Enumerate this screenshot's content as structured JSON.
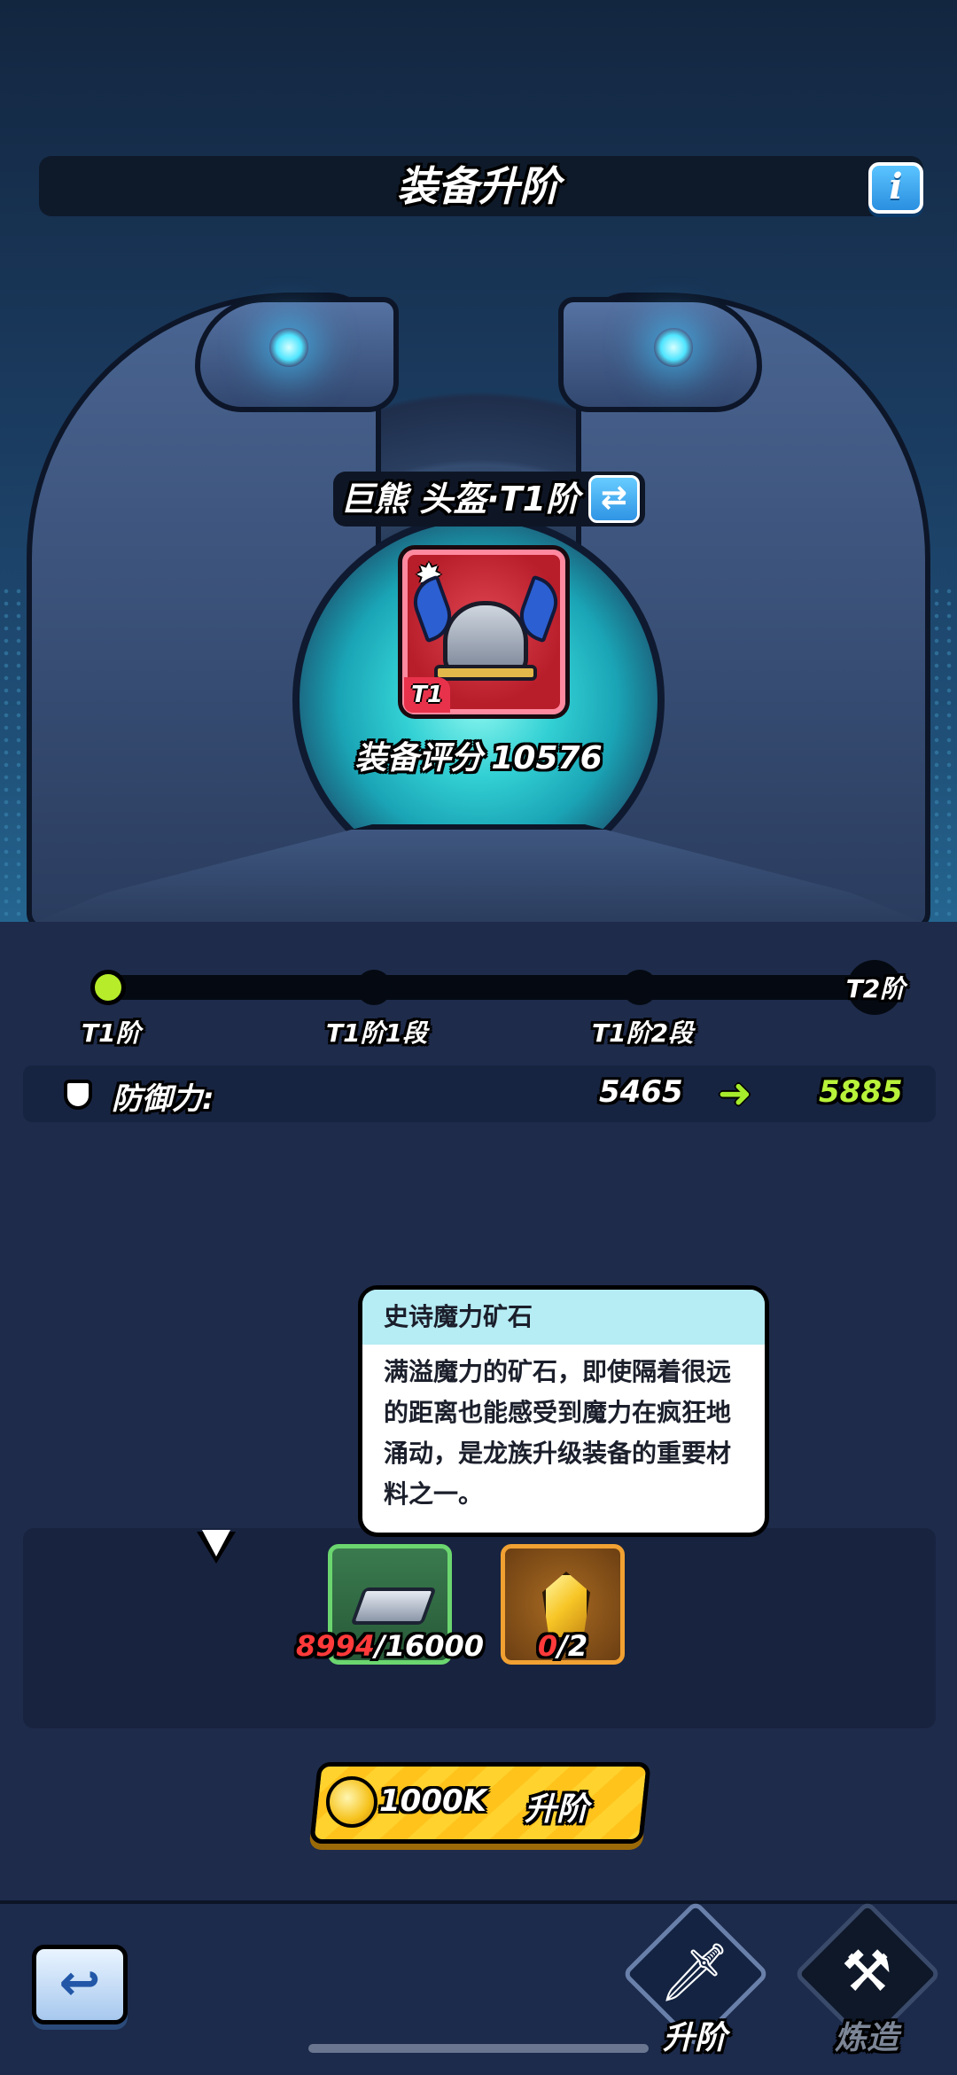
{
  "header": {
    "title": "装备升阶",
    "info_button": "i"
  },
  "item": {
    "name": "巨熊 头盔·T1阶",
    "swap_icon": "⇄",
    "tier_badge": "T1",
    "score_label": "装备评分",
    "score_value": "10576"
  },
  "progress": {
    "stages": [
      "T1阶",
      "T1阶1段",
      "T1阶2段"
    ],
    "final_stage": "T2阶",
    "current_index": 0
  },
  "stat": {
    "label": "防御力:",
    "old_value": "5465",
    "new_value": "5885",
    "icon": "shield-icon"
  },
  "tooltip": {
    "title": "史诗魔力矿石",
    "body": "满溢魔力的矿石，即使隔着很远的距离也能感受到魔力在疯狂地涌动，是龙族升级装备的重要材料之一。"
  },
  "materials": [
    {
      "name": "silver-ingot",
      "have": "8994",
      "need": "/16000"
    },
    {
      "name": "epic-mana-ore",
      "have": "0",
      "need": "/2"
    }
  ],
  "upgrade": {
    "cost": "1000K",
    "label": "升阶"
  },
  "nav": {
    "back_icon": "↩",
    "tabs": [
      {
        "label": "升阶",
        "icon": "sword-upgrade-icon"
      },
      {
        "label": "炼造",
        "icon": "anvil-hammer-icon"
      }
    ]
  },
  "colors": {
    "accent_green": "#b8f23a",
    "gold": "#ffd22e",
    "insufficient_red": "#ff3a3a"
  }
}
